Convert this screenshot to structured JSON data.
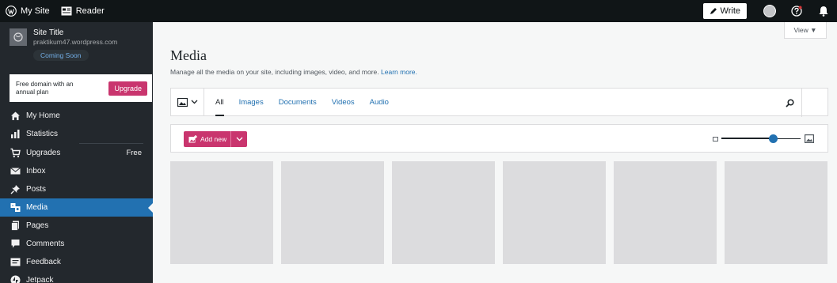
{
  "masterbar": {
    "my_site": "My Site",
    "reader": "Reader",
    "write": "Write"
  },
  "site": {
    "title": "Site Title",
    "url": "praktikum47.wordpress.com",
    "status": "Coming Soon"
  },
  "upsell": {
    "text": "Free domain with an annual plan",
    "button": "Upgrade"
  },
  "nav": [
    {
      "label": "My Home",
      "icon": "home-icon"
    },
    {
      "label": "Statistics",
      "icon": "stats-icon"
    },
    {
      "label": "Upgrades",
      "icon": "cart-icon",
      "badge": "Free"
    },
    {
      "label": "Inbox",
      "icon": "mail-icon"
    },
    {
      "label": "Posts",
      "icon": "pin-icon"
    },
    {
      "label": "Media",
      "icon": "media-icon",
      "active": true
    },
    {
      "label": "Pages",
      "icon": "pages-icon"
    },
    {
      "label": "Comments",
      "icon": "comment-icon"
    },
    {
      "label": "Feedback",
      "icon": "feedback-icon"
    },
    {
      "label": "Jetpack",
      "icon": "jetpack-icon"
    }
  ],
  "view_button": "View ▼",
  "page": {
    "title": "Media",
    "subtitle": "Manage all the media on your site, including images, video, and more.",
    "learn_more": "Learn more."
  },
  "filter": {
    "tabs": [
      "All",
      "Images",
      "Documents",
      "Videos",
      "Audio"
    ],
    "active_tab": "All"
  },
  "toolbar": {
    "add_new": "Add new",
    "zoom_level": 0.65
  },
  "media_count": 6,
  "colors": {
    "accent": "#2271b1",
    "brand_pink": "#c9356e",
    "sidebar_bg": "#23282d",
    "masterbar_bg": "#101517"
  }
}
